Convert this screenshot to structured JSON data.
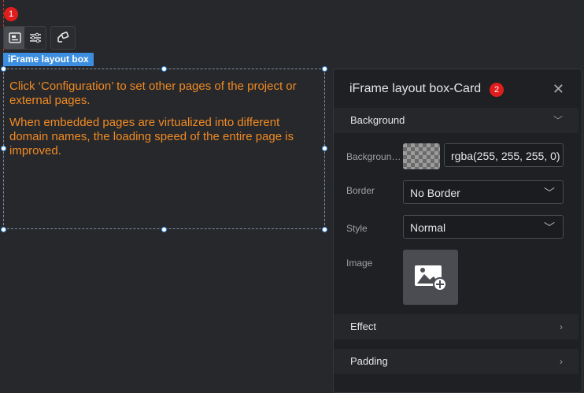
{
  "markers": {
    "one": "1",
    "two": "2"
  },
  "toolbar": {
    "icons": [
      "image-settings-icon",
      "sliders-icon",
      "link-icon"
    ]
  },
  "component": {
    "tag": "iFrame layout box"
  },
  "iframe": {
    "text1": "Click ‘Configuration’ to set other pages of the project or external pages.",
    "text2": "When embedded pages are virtualized into different domain names, the loading speed of the entire page is improved."
  },
  "panel": {
    "title": "iFrame layout box-Card",
    "sections": {
      "background": "Background",
      "effect": "Effect",
      "padding": "Padding"
    },
    "fields": {
      "background_label": "Backgroun…",
      "background_value": "rgba(255, 255, 255, 0)",
      "border_label": "Border",
      "border_value": "No Border",
      "style_label": "Style",
      "style_value": "Normal",
      "image_label": "Image"
    }
  },
  "colors": {
    "accent": "#3b8ee0",
    "text_orange": "#f08a24",
    "marker_red": "#e01d1d"
  }
}
